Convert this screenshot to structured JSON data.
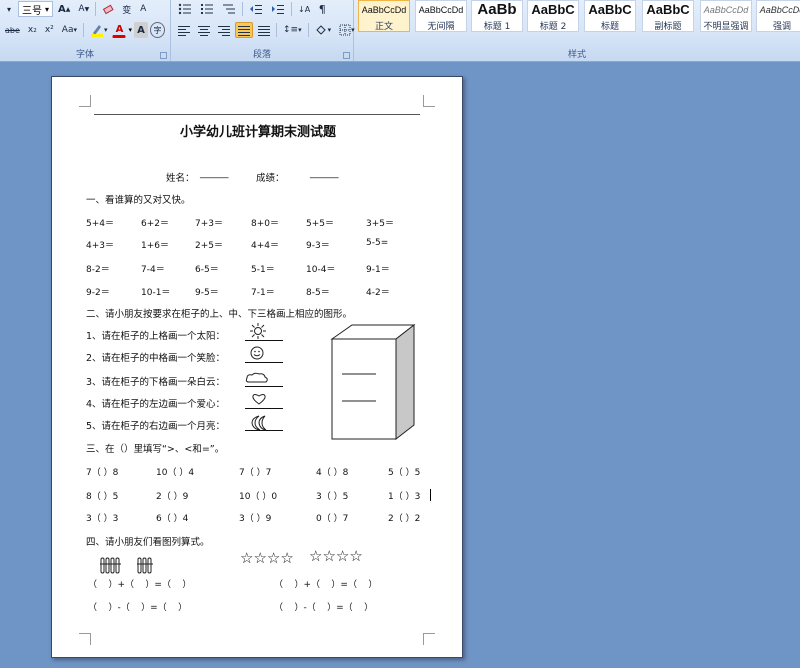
{
  "ribbon": {
    "font": {
      "size_combo": "三号",
      "row1": [
        "A",
        "A"
      ],
      "row2": [
        "abe",
        "x₂",
        "x²",
        "Aa"
      ],
      "highlight_icon": "highlighter-icon",
      "font_color_icon": "font-color-icon",
      "char_border": "A",
      "char_enclose": "字",
      "group_label": "字体"
    },
    "paragraph": {
      "group_label": "段落"
    },
    "styles": {
      "group_label": "样式",
      "items": [
        {
          "sample": "AaBbCcDd",
          "name": "正文",
          "selected": true
        },
        {
          "sample": "AaBbCcDd",
          "name": "无间隔",
          "selected": false
        },
        {
          "sample": "AaBb",
          "name": "标题 1",
          "selected": false
        },
        {
          "sample": "AaBbC",
          "name": "标题 2",
          "selected": false
        },
        {
          "sample": "AaBbC",
          "name": "标题",
          "selected": false
        },
        {
          "sample": "AaBbC",
          "name": "副标题",
          "selected": false
        },
        {
          "sample": "AaBbCcDd",
          "name": "不明显强调",
          "selected": false
        },
        {
          "sample": "AaBbCcDd",
          "name": "强调",
          "selected": false
        },
        {
          "sample": "A",
          "name": "明",
          "selected": false
        }
      ]
    }
  },
  "doc": {
    "title": "小学幼儿班计算期末测试题",
    "name_label": "姓名：",
    "name_blank": "______",
    "score_label": "成绩：",
    "score_blank": "______",
    "sec1": "一、看谁算的又对又快。",
    "sec1_rows": [
      [
        "5+4＝",
        "6+2＝",
        "7+3＝",
        "8+0＝",
        "5+5＝",
        "3+5＝"
      ],
      [
        "4+3＝",
        "1+6＝",
        "2+5＝",
        "4+4＝",
        "9-3＝",
        "5-5="
      ],
      [
        "8-2＝",
        "7-4＝",
        "6-5＝",
        "5-1＝",
        "10-4＝",
        "9-1＝"
      ],
      [
        "9-2＝",
        "10-1＝",
        "9-5＝",
        "7-1＝",
        "8-5＝",
        "4-2＝"
      ]
    ],
    "sec2": "二、请小朋友按要求在柜子的上、中、下三格画上相应的图形。",
    "sec2_items": [
      "1、请在柜子的上格画一个太阳：",
      "2、请在柜子的中格画一个笑脸：",
      "3、请在柜子的下格画一朵白云：",
      "4、请在柜子的左边画一个爱心：",
      "5、请在柜子的右边画一个月亮："
    ],
    "sec3": "三、在（）里填写“>、<和=”。",
    "sec3_rows": [
      [
        "7（ ）8",
        "10（ ）4",
        "7（ ）7",
        "4（ ）8",
        "5（ ）5"
      ],
      [
        "8（ ）5",
        "2（ ）9",
        "10（ ）0",
        "3（ ）5",
        "1（ ）3"
      ],
      [
        "3（ ）3",
        "6（ ）4",
        "3（ ）9",
        "0（ ）7",
        "2（ ）2"
      ]
    ],
    "sec4": "四、请小朋友们看图列算式。",
    "stars_left": "☆☆☆☆",
    "stars_right": "☆☆☆☆",
    "eq_rows": [
      [
        "（    ）+（    ）=（    ）",
        "（    ）+（    ）=（    ）"
      ],
      [
        "（    ）-（    ）=（    ）",
        "（    ）-（    ）=（    ）"
      ]
    ]
  }
}
